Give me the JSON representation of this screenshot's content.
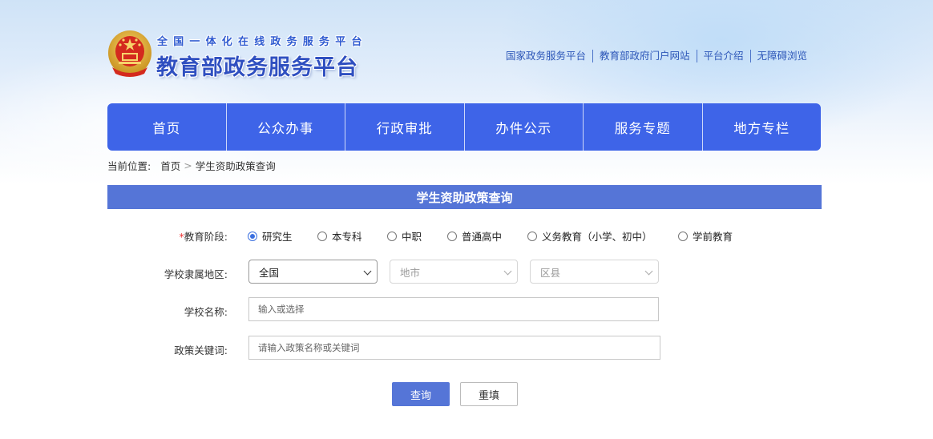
{
  "header": {
    "subtitle": "全国一体化在线政务服务平台",
    "title": "教育部政务服务平台",
    "links": [
      "国家政务服务平台",
      "教育部政府门户网站",
      "平台介绍",
      "无障碍浏览"
    ]
  },
  "nav": [
    "首页",
    "公众办事",
    "行政审批",
    "办件公示",
    "服务专题",
    "地方专栏"
  ],
  "breadcrumb": {
    "label": "当前位置:",
    "home": "首页",
    "separator": ">",
    "current": "学生资助政策查询"
  },
  "section_title": "学生资助政策查询",
  "form": {
    "stage": {
      "required_mark": "*",
      "label": "教育阶段:",
      "options": [
        "研究生",
        "本专科",
        "中职",
        "普通高中",
        "义务教育（小学、初中）",
        "学前教育"
      ],
      "selected": "研究生"
    },
    "region": {
      "label": "学校隶属地区:",
      "province": "全国",
      "city": "地市",
      "county": "区县"
    },
    "school": {
      "label": "学校名称:",
      "placeholder": "输入或选择"
    },
    "keyword": {
      "label": "政策关键词:",
      "placeholder": "请输入政策名称或关键词"
    },
    "buttons": {
      "search": "查询",
      "reset": "重填"
    }
  },
  "colors": {
    "nav_bg": "#3e64e8",
    "section_bg": "#5575d7",
    "link": "#2c56b8",
    "required": "#e33333"
  }
}
